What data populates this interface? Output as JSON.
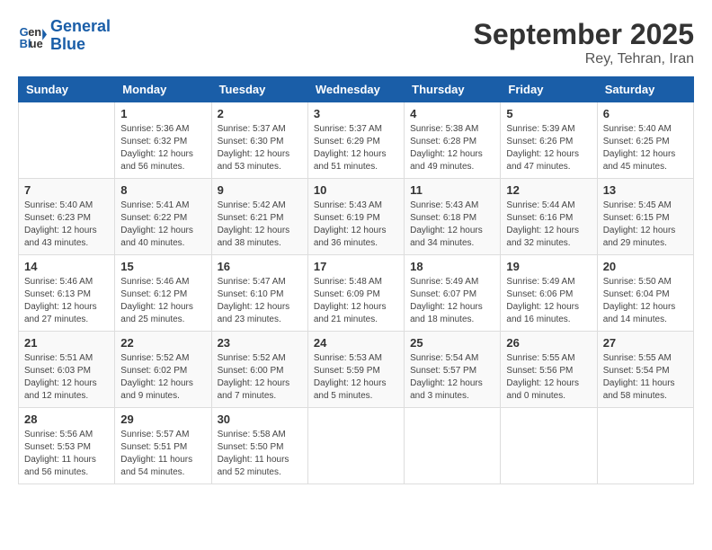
{
  "logo": {
    "line1": "General",
    "line2": "Blue"
  },
  "title": "September 2025",
  "location": "Rey, Tehran, Iran",
  "days_of_week": [
    "Sunday",
    "Monday",
    "Tuesday",
    "Wednesday",
    "Thursday",
    "Friday",
    "Saturday"
  ],
  "weeks": [
    [
      {
        "day": "",
        "info": ""
      },
      {
        "day": "1",
        "info": "Sunrise: 5:36 AM\nSunset: 6:32 PM\nDaylight: 12 hours\nand 56 minutes."
      },
      {
        "day": "2",
        "info": "Sunrise: 5:37 AM\nSunset: 6:30 PM\nDaylight: 12 hours\nand 53 minutes."
      },
      {
        "day": "3",
        "info": "Sunrise: 5:37 AM\nSunset: 6:29 PM\nDaylight: 12 hours\nand 51 minutes."
      },
      {
        "day": "4",
        "info": "Sunrise: 5:38 AM\nSunset: 6:28 PM\nDaylight: 12 hours\nand 49 minutes."
      },
      {
        "day": "5",
        "info": "Sunrise: 5:39 AM\nSunset: 6:26 PM\nDaylight: 12 hours\nand 47 minutes."
      },
      {
        "day": "6",
        "info": "Sunrise: 5:40 AM\nSunset: 6:25 PM\nDaylight: 12 hours\nand 45 minutes."
      }
    ],
    [
      {
        "day": "7",
        "info": "Sunrise: 5:40 AM\nSunset: 6:23 PM\nDaylight: 12 hours\nand 43 minutes."
      },
      {
        "day": "8",
        "info": "Sunrise: 5:41 AM\nSunset: 6:22 PM\nDaylight: 12 hours\nand 40 minutes."
      },
      {
        "day": "9",
        "info": "Sunrise: 5:42 AM\nSunset: 6:21 PM\nDaylight: 12 hours\nand 38 minutes."
      },
      {
        "day": "10",
        "info": "Sunrise: 5:43 AM\nSunset: 6:19 PM\nDaylight: 12 hours\nand 36 minutes."
      },
      {
        "day": "11",
        "info": "Sunrise: 5:43 AM\nSunset: 6:18 PM\nDaylight: 12 hours\nand 34 minutes."
      },
      {
        "day": "12",
        "info": "Sunrise: 5:44 AM\nSunset: 6:16 PM\nDaylight: 12 hours\nand 32 minutes."
      },
      {
        "day": "13",
        "info": "Sunrise: 5:45 AM\nSunset: 6:15 PM\nDaylight: 12 hours\nand 29 minutes."
      }
    ],
    [
      {
        "day": "14",
        "info": "Sunrise: 5:46 AM\nSunset: 6:13 PM\nDaylight: 12 hours\nand 27 minutes."
      },
      {
        "day": "15",
        "info": "Sunrise: 5:46 AM\nSunset: 6:12 PM\nDaylight: 12 hours\nand 25 minutes."
      },
      {
        "day": "16",
        "info": "Sunrise: 5:47 AM\nSunset: 6:10 PM\nDaylight: 12 hours\nand 23 minutes."
      },
      {
        "day": "17",
        "info": "Sunrise: 5:48 AM\nSunset: 6:09 PM\nDaylight: 12 hours\nand 21 minutes."
      },
      {
        "day": "18",
        "info": "Sunrise: 5:49 AM\nSunset: 6:07 PM\nDaylight: 12 hours\nand 18 minutes."
      },
      {
        "day": "19",
        "info": "Sunrise: 5:49 AM\nSunset: 6:06 PM\nDaylight: 12 hours\nand 16 minutes."
      },
      {
        "day": "20",
        "info": "Sunrise: 5:50 AM\nSunset: 6:04 PM\nDaylight: 12 hours\nand 14 minutes."
      }
    ],
    [
      {
        "day": "21",
        "info": "Sunrise: 5:51 AM\nSunset: 6:03 PM\nDaylight: 12 hours\nand 12 minutes."
      },
      {
        "day": "22",
        "info": "Sunrise: 5:52 AM\nSunset: 6:02 PM\nDaylight: 12 hours\nand 9 minutes."
      },
      {
        "day": "23",
        "info": "Sunrise: 5:52 AM\nSunset: 6:00 PM\nDaylight: 12 hours\nand 7 minutes."
      },
      {
        "day": "24",
        "info": "Sunrise: 5:53 AM\nSunset: 5:59 PM\nDaylight: 12 hours\nand 5 minutes."
      },
      {
        "day": "25",
        "info": "Sunrise: 5:54 AM\nSunset: 5:57 PM\nDaylight: 12 hours\nand 3 minutes."
      },
      {
        "day": "26",
        "info": "Sunrise: 5:55 AM\nSunset: 5:56 PM\nDaylight: 12 hours\nand 0 minutes."
      },
      {
        "day": "27",
        "info": "Sunrise: 5:55 AM\nSunset: 5:54 PM\nDaylight: 11 hours\nand 58 minutes."
      }
    ],
    [
      {
        "day": "28",
        "info": "Sunrise: 5:56 AM\nSunset: 5:53 PM\nDaylight: 11 hours\nand 56 minutes."
      },
      {
        "day": "29",
        "info": "Sunrise: 5:57 AM\nSunset: 5:51 PM\nDaylight: 11 hours\nand 54 minutes."
      },
      {
        "day": "30",
        "info": "Sunrise: 5:58 AM\nSunset: 5:50 PM\nDaylight: 11 hours\nand 52 minutes."
      },
      {
        "day": "",
        "info": ""
      },
      {
        "day": "",
        "info": ""
      },
      {
        "day": "",
        "info": ""
      },
      {
        "day": "",
        "info": ""
      }
    ]
  ]
}
